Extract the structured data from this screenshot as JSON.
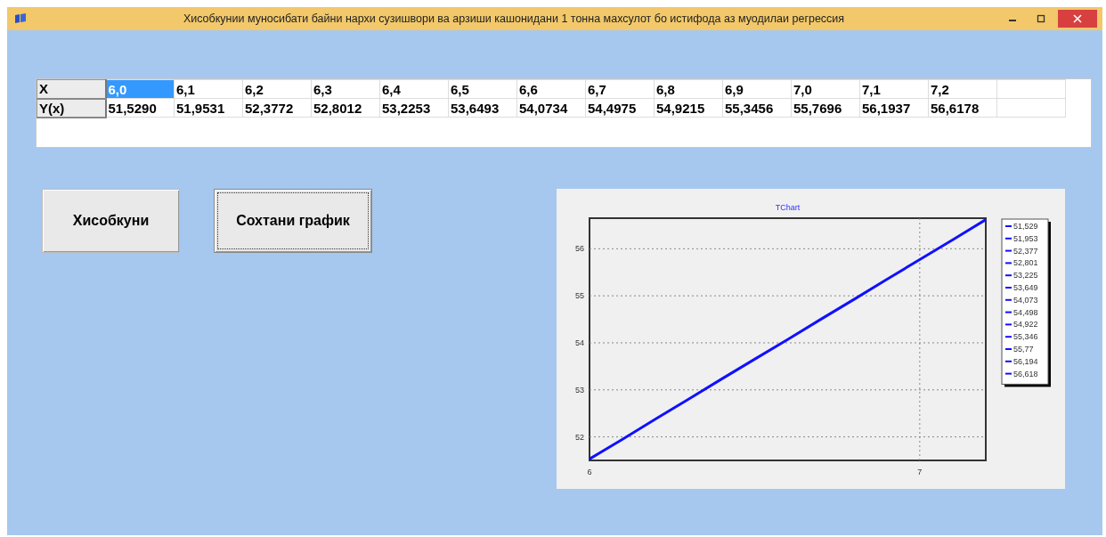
{
  "window": {
    "title": "Хисобкунии муносибати байни нархи сузишвори  ва арзиши кашонидани 1 тонна махсулот бо истифода аз муодилаи регрессия"
  },
  "table": {
    "row_headers": [
      "X",
      "Y(x)"
    ],
    "x_cells": [
      {
        "text": "6,0",
        "selected": true
      },
      {
        "text": "6,1",
        "selected": false
      },
      {
        "text": "6,2",
        "selected": false
      },
      {
        "text": "6,3",
        "selected": false
      },
      {
        "text": "6,4",
        "selected": false
      },
      {
        "text": "6,5",
        "selected": false
      },
      {
        "text": "6,6",
        "selected": false
      },
      {
        "text": "6,7",
        "selected": false
      },
      {
        "text": "6,8",
        "selected": false
      },
      {
        "text": "6,9",
        "selected": false
      },
      {
        "text": "7,0",
        "selected": false
      },
      {
        "text": "7,1",
        "selected": false
      },
      {
        "text": "7,2",
        "selected": false
      }
    ],
    "y_cells": [
      "51,5290",
      "51,9531",
      "52,3772",
      "52,8012",
      "53,2253",
      "53,6493",
      "54,0734",
      "54,4975",
      "54,9215",
      "55,3456",
      "55,7696",
      "56,1937",
      "56,6178"
    ]
  },
  "buttons": [
    "Хисобкуни",
    "Сохтани график"
  ],
  "chart": {
    "chart_data": {
      "type": "line",
      "title": "TChart",
      "x": [
        6.0,
        6.1,
        6.2,
        6.3,
        6.4,
        6.5,
        6.6,
        6.7,
        6.8,
        6.9,
        7.0,
        7.1,
        7.2
      ],
      "series": [
        {
          "color": "#1010ff",
          "values": [
            51.53,
            51.95,
            52.38,
            52.8,
            53.23,
            53.65,
            54.07,
            54.5,
            54.92,
            55.35,
            55.77,
            56.19,
            56.62
          ]
        }
      ],
      "xlim": [
        6,
        7.2
      ],
      "ylim": [
        51.5,
        56.65
      ],
      "xticks": [
        6,
        7
      ],
      "yticks": [
        52,
        53,
        54,
        55,
        56
      ],
      "grid": true
    },
    "legend": [
      "51,529",
      "51,953",
      "52,377",
      "52,801",
      "53,225",
      "53,649",
      "54,073",
      "54,498",
      "54,922",
      "55,346",
      "55,77",
      "56,194",
      "56,618"
    ]
  }
}
